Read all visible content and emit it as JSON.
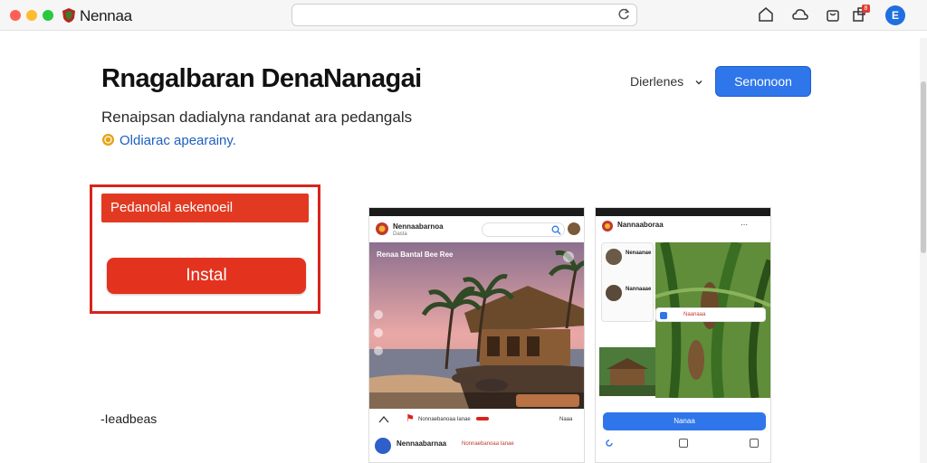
{
  "app": {
    "name": "Nennaa"
  },
  "header": {
    "title": "Rnagalbaran DenaNanagai",
    "language_label": "Dierlenes",
    "primary_button": "Senonoon",
    "subtitle": "Renaipsan dadialyna randanat ara pedangals",
    "note": "Oldiarac apearainy."
  },
  "install": {
    "label": "Pedanolal aekenoeil",
    "button": "Instal"
  },
  "footer_link": "-Ieadbeas",
  "phone1": {
    "app_title": "Nennaabarnoa",
    "app_sub": "Dasta",
    "hero_caption": "Renaa Bantal Bee Ree",
    "post_title": "Nennaabarnaa",
    "post_author": "Nonnaebanoaa Ianae",
    "more_label": "Naaa"
  },
  "phone2": {
    "app_title": "Nannaaboraa",
    "card1_title": "Nenaanae",
    "card2_title": "Nannaaae",
    "tag": "Naanaaa",
    "button": "Nanaa"
  },
  "notifications": {
    "count": "8"
  },
  "account": {
    "initial": "E"
  },
  "colors": {
    "accent": "#2f76ea",
    "install_red": "#e3331f",
    "border_red": "#d8241c"
  },
  "icons": [
    "home-icon",
    "cloud-icon",
    "bag-icon",
    "extensions-icon",
    "reload-icon",
    "chevron-down-icon",
    "coin-icon"
  ]
}
